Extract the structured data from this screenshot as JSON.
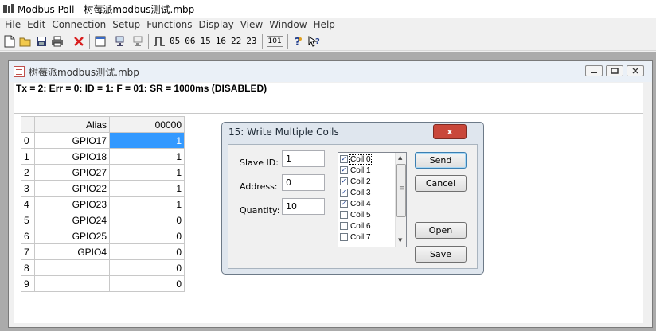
{
  "window": {
    "title": "Modbus Poll - 树莓派modbus测试.mbp"
  },
  "menu": [
    "File",
    "Edit",
    "Connection",
    "Setup",
    "Functions",
    "Display",
    "View",
    "Window",
    "Help"
  ],
  "toolbar": {
    "function_codes": [
      "05",
      "06",
      "15",
      "16",
      "22",
      "23"
    ],
    "badge_101": "101"
  },
  "document": {
    "title": "树莓派modbus测试.mbp",
    "status_line": "Tx = 2: Err = 0: ID = 1: F = 01: SR = 1000ms  (DISABLED)"
  },
  "table": {
    "headers": {
      "index": "",
      "alias": "Alias",
      "address": "00000"
    },
    "rows": [
      {
        "index": "0",
        "alias": "GPIO17",
        "value": "1",
        "selected": true
      },
      {
        "index": "1",
        "alias": "GPIO18",
        "value": "1"
      },
      {
        "index": "2",
        "alias": "GPIO27",
        "value": "1"
      },
      {
        "index": "3",
        "alias": "GPIO22",
        "value": "1"
      },
      {
        "index": "4",
        "alias": "GPIO23",
        "value": "1"
      },
      {
        "index": "5",
        "alias": "GPIO24",
        "value": "0"
      },
      {
        "index": "6",
        "alias": "GPIO25",
        "value": "0"
      },
      {
        "index": "7",
        "alias": "GPIO4",
        "value": "0"
      },
      {
        "index": "8",
        "alias": "",
        "value": "0"
      },
      {
        "index": "9",
        "alias": "",
        "value": "0"
      }
    ]
  },
  "dialog": {
    "title": "15: Write Multiple Coils",
    "close_label": "x",
    "fields": {
      "slave_id": {
        "label": "Slave ID:",
        "value": "1"
      },
      "address": {
        "label": "Address:",
        "value": "0"
      },
      "quantity": {
        "label": "Quantity:",
        "value": "10"
      }
    },
    "coils": [
      {
        "label": "Coil 0",
        "checked": true
      },
      {
        "label": "Coil 1",
        "checked": true
      },
      {
        "label": "Coil 2",
        "checked": true
      },
      {
        "label": "Coil 3",
        "checked": true
      },
      {
        "label": "Coil 4",
        "checked": true
      },
      {
        "label": "Coil 5",
        "checked": false
      },
      {
        "label": "Coil 6",
        "checked": false
      },
      {
        "label": "Coil 7",
        "checked": false
      }
    ],
    "buttons": {
      "send": "Send",
      "cancel": "Cancel",
      "open": "Open",
      "save": "Save"
    }
  }
}
